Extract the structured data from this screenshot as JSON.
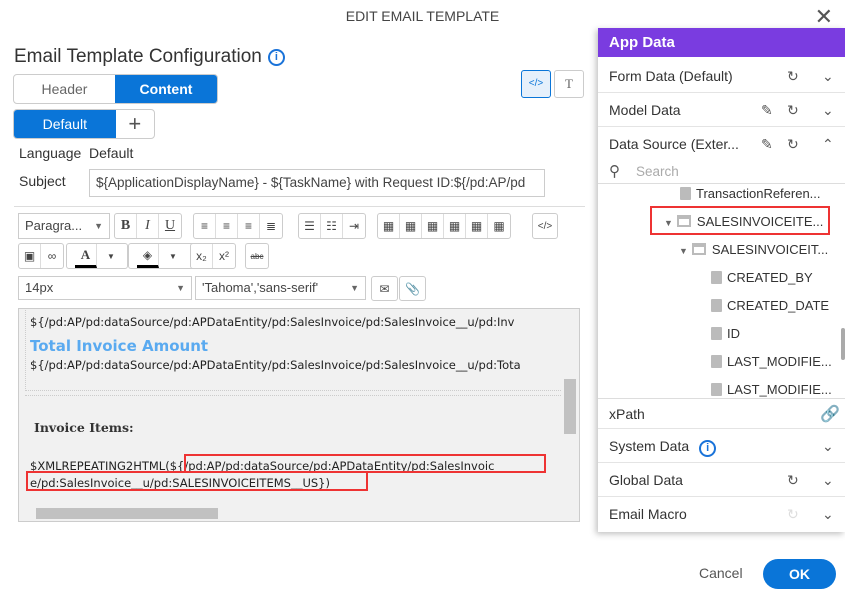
{
  "dialog": {
    "title": "EDIT EMAIL TEMPLATE",
    "close_icon": "close-icon"
  },
  "config": {
    "title": "Email Template Configuration",
    "tabs": [
      "Header",
      "Content"
    ],
    "active_tab": "Content",
    "lang_tabs": [
      "Default"
    ],
    "add_label": "+",
    "language_label": "Language",
    "language_value": "Default",
    "subject_label": "Subject",
    "subject_value": "${ApplicationDisplayName} - ${TaskName} with Request ID:${/pd:AP/pd"
  },
  "toolbar": {
    "paragraph": "Paragra...",
    "font_size": "14px",
    "font_family": "'Tahoma','sans-serif'",
    "bold": "B",
    "italic": "I",
    "underline": "U",
    "strike": "abc",
    "code": "</>"
  },
  "editor": {
    "line1": "${/pd:AP/pd:dataSource/pd:APDataEntity/pd:SalesInvoice/pd:SalesInvoice__u/pd:Inv",
    "heading2": "Total Invoice Amount",
    "line2": "${/pd:AP/pd:dataSource/pd:APDataEntity/pd:SalesInvoice/pd:SalesInvoice__u/pd:Tota",
    "items_heading": "Invoice Items:",
    "macro": "$XMLREPEATING2HTML(",
    "path1": "${/pd:AP/pd:dataSource/pd:APDataEntity/pd:SalesInvoic",
    "path2": "e/pd:SalesInvoice__u/pd:SALESINVOICEITEMS__US}",
    "close_paren": ")",
    "heading_color": "#5aaaf0"
  },
  "app_data": {
    "title": "App Data",
    "accent": "#7a3ce0",
    "sections": [
      "Form Data (Default)",
      "Model Data",
      "Data Source (Exter...",
      "System Data",
      "Global Data",
      "Email Macro"
    ],
    "search_placeholder": "Search",
    "tree": [
      "TransactionReferen...",
      "SALESINVOICEITE...",
      "SALESINVOICEIT...",
      "CREATED_BY",
      "CREATED_DATE",
      "ID",
      "LAST_MODIFIE...",
      "LAST_MODIFIE..."
    ],
    "xpath_label": "xPath"
  },
  "footer": {
    "cancel": "Cancel",
    "ok": "OK"
  }
}
